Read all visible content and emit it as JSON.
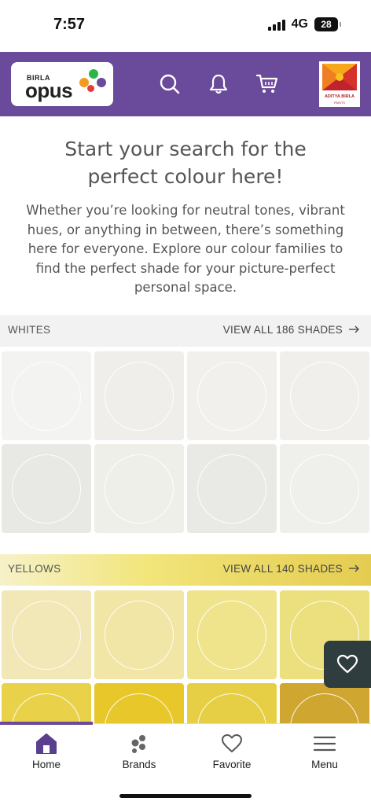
{
  "status_bar": {
    "time": "7:57",
    "network": "4G",
    "battery": "28"
  },
  "header": {
    "logo_small": "BIRLA",
    "logo_main": "opus",
    "brand_name": "ADITYA BIRLA",
    "brand_sub": "PAINTS",
    "header_color": "#6a4a9a"
  },
  "intro": {
    "title": "Start your search for the perfect colour here!",
    "text": "Whether you’re looking for neutral tones, vibrant hues, or anything in between, there’s something here for everyone. Explore our colour families to find the perfect shade for your picture-perfect personal space."
  },
  "sections": [
    {
      "title": "WHITES",
      "link": "VIEW ALL 186 SHADES",
      "swatches": [
        "#f3f3f1",
        "#efeeea",
        "#f1f0ec",
        "#f0efec",
        "#e8e8e5",
        "#eeefe8",
        "#e9eae5",
        "#efefec"
      ]
    },
    {
      "title": "YELLOWS",
      "link": "VIEW ALL 140 SHADES",
      "swatches": [
        "#f2e7b6",
        "#f2e6a6",
        "#efe48b",
        "#ece07e",
        "#ead14a",
        "#e8c72a",
        "#e6cf44",
        "#cfa730"
      ]
    }
  ],
  "nav": {
    "items": [
      {
        "label": "Home",
        "icon": "home-icon"
      },
      {
        "label": "Brands",
        "icon": "brands-icon"
      },
      {
        "label": "Favorite",
        "icon": "heart-icon"
      },
      {
        "label": "Menu",
        "icon": "menu-icon"
      }
    ],
    "active_index": 0
  }
}
